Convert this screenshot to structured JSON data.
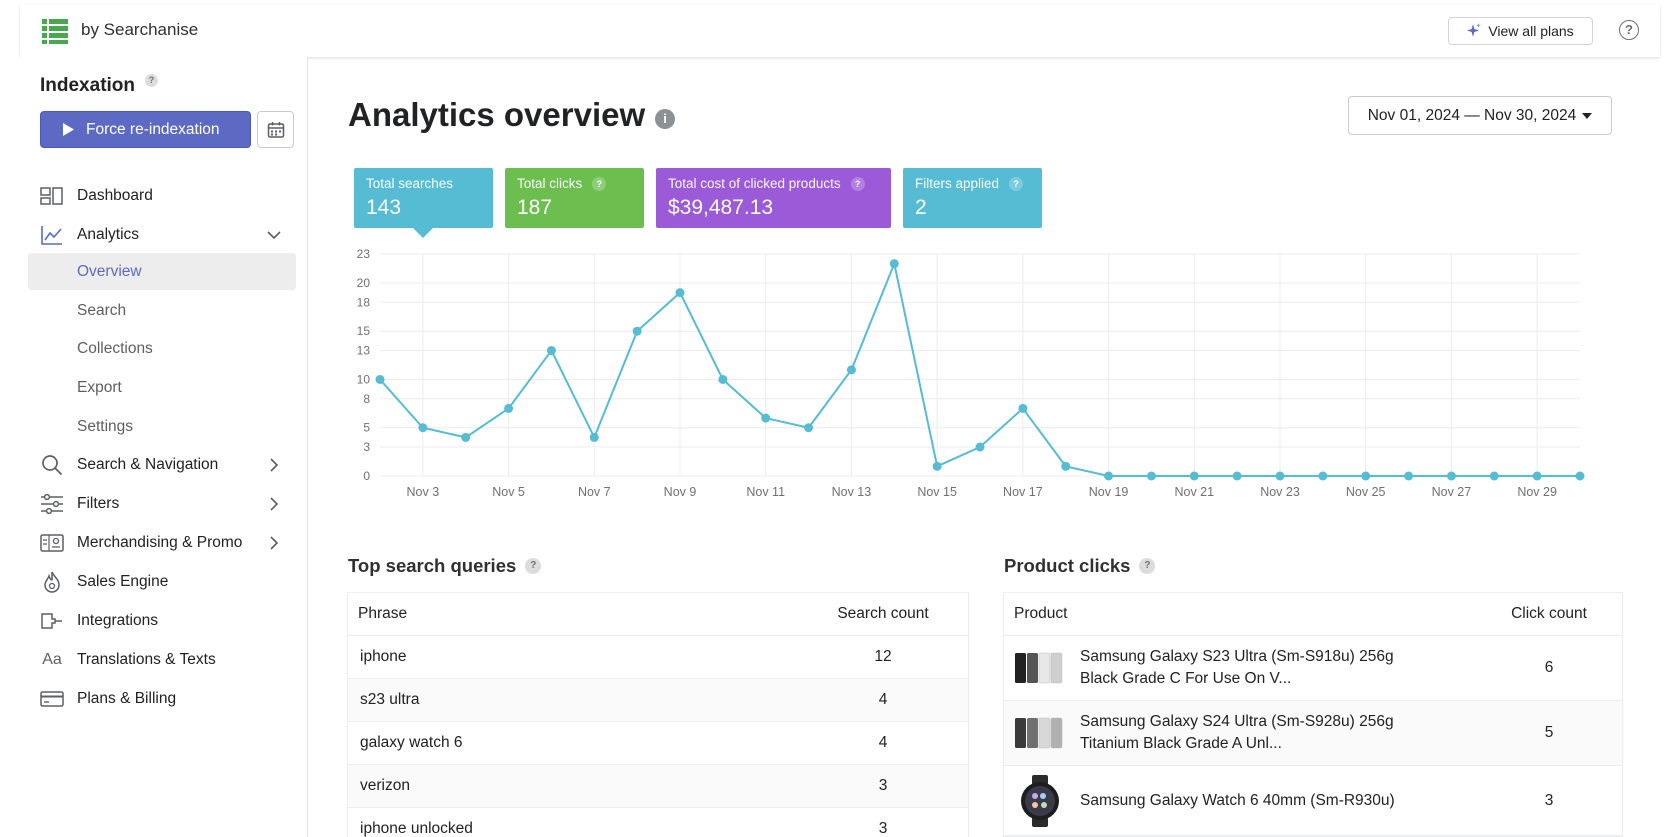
{
  "app": {
    "brand": "by Searchanise",
    "view_plans_label": "View all plans",
    "help_glyph": "?"
  },
  "sidebar": {
    "indexation_title": "Indexation",
    "force_button_label": "Force re-indexation",
    "items": [
      {
        "label": "Dashboard",
        "icon": "dashboard-icon"
      },
      {
        "label": "Analytics",
        "icon": "analytics-icon"
      },
      {
        "label": "Search & Navigation",
        "icon": "search-icon"
      },
      {
        "label": "Filters",
        "icon": "filters-icon"
      },
      {
        "label": "Merchandising & Promo",
        "icon": "merchandising-icon"
      },
      {
        "label": "Sales Engine",
        "icon": "sales-engine-icon"
      },
      {
        "label": "Integrations",
        "icon": "integrations-icon"
      },
      {
        "label": "Translations & Texts",
        "icon": "translations-icon",
        "glyph": "Aa"
      },
      {
        "label": "Plans & Billing",
        "icon": "billing-icon"
      }
    ],
    "analytics_sub": [
      "Overview",
      "Search",
      "Collections",
      "Export",
      "Settings"
    ],
    "active_sub": "Overview"
  },
  "main": {
    "title": "Analytics overview",
    "info_glyph": "i",
    "date_range": "Nov 01, 2024 — Nov 30, 2024",
    "stats": [
      {
        "label": "Total searches",
        "value": "143",
        "color": "#55bcd3"
      },
      {
        "label": "Total clicks",
        "value": "187",
        "color": "#6cbf4e"
      },
      {
        "label": "Total cost of clicked products",
        "value": "$39,487.13",
        "color": "#9b5ad7"
      },
      {
        "label": "Filters applied",
        "value": "2",
        "color": "#55bcd3"
      }
    ]
  },
  "chart_data": {
    "type": "line",
    "x": [
      "Nov 2",
      "Nov 3",
      "Nov 4",
      "Nov 5",
      "Nov 6",
      "Nov 7",
      "Nov 8",
      "Nov 9",
      "Nov 10",
      "Nov 11",
      "Nov 12",
      "Nov 13",
      "Nov 14",
      "Nov 15",
      "Nov 16",
      "Nov 17",
      "Nov 18",
      "Nov 19",
      "Nov 20",
      "Nov 21",
      "Nov 22",
      "Nov 23",
      "Nov 24",
      "Nov 25",
      "Nov 26",
      "Nov 27",
      "Nov 28",
      "Nov 29",
      "Nov 30"
    ],
    "values": [
      10,
      5,
      4,
      7,
      13,
      4,
      15,
      19,
      10,
      6,
      5,
      11,
      22,
      1,
      3,
      7,
      1,
      0,
      0,
      0,
      0,
      0,
      0,
      0,
      0,
      0,
      0,
      0,
      0
    ],
    "tick_labels_x": [
      "Nov 3",
      "Nov 5",
      "Nov 7",
      "Nov 9",
      "Nov 11",
      "Nov 13",
      "Nov 15",
      "Nov 17",
      "Nov 19",
      "Nov 21",
      "Nov 23",
      "Nov 25",
      "Nov 27",
      "Nov 29"
    ],
    "tick_labels_y": [
      "0",
      "3",
      "5",
      "8",
      "10",
      "13",
      "15",
      "18",
      "20",
      "23"
    ],
    "ylim": [
      0,
      23
    ],
    "color": "#55bcd3",
    "grid": true
  },
  "top_queries": {
    "title": "Top search queries",
    "columns": [
      "Phrase",
      "Search count"
    ],
    "rows": [
      {
        "phrase": "iphone",
        "count": "12"
      },
      {
        "phrase": "s23 ultra",
        "count": "4"
      },
      {
        "phrase": "galaxy watch 6",
        "count": "4"
      },
      {
        "phrase": "verizon",
        "count": "3"
      },
      {
        "phrase": "iphone unlocked",
        "count": "3"
      }
    ]
  },
  "product_clicks": {
    "title": "Product clicks",
    "columns": [
      "Product",
      "Click count"
    ],
    "rows": [
      {
        "line1": "Samsung Galaxy S23 Ultra (Sm-S918u) 256g",
        "line2": "Black Grade C For Use On V...",
        "count": "6"
      },
      {
        "line1": "Samsung Galaxy S24 Ultra (Sm-S928u) 256g",
        "line2": "Titanium Black Grade A Unl...",
        "count": "5"
      },
      {
        "line1": "Samsung Galaxy Watch 6 40mm (Sm-R930u)",
        "line2": "",
        "count": "3"
      }
    ]
  }
}
